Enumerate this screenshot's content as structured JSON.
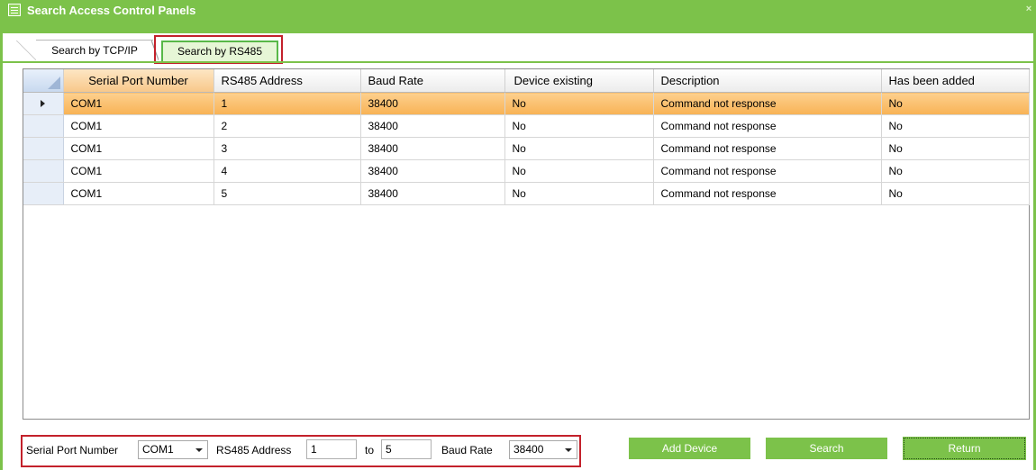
{
  "window": {
    "title": "Search Access Control Panels",
    "close_glyph": "×",
    "accent_color": "#7cc24a",
    "highlight_color": "#c3212b"
  },
  "tabs": [
    {
      "label": "Search by TCP/IP",
      "active": false
    },
    {
      "label": "Search by RS485",
      "active": true
    }
  ],
  "grid": {
    "columns": [
      "Serial Port Number",
      "RS485 Address",
      "Baud Rate",
      "Device existing",
      "Description",
      "Has been added"
    ],
    "rows": [
      {
        "port": "COM1",
        "address": "1",
        "baud": "38400",
        "exists": "No",
        "description": "Command not response",
        "added": "No",
        "selected": true
      },
      {
        "port": "COM1",
        "address": "2",
        "baud": "38400",
        "exists": "No",
        "description": "Command not response",
        "added": "No",
        "selected": false
      },
      {
        "port": "COM1",
        "address": "3",
        "baud": "38400",
        "exists": "No",
        "description": "Command not response",
        "added": "No",
        "selected": false
      },
      {
        "port": "COM1",
        "address": "4",
        "baud": "38400",
        "exists": "No",
        "description": "Command not response",
        "added": "No",
        "selected": false
      },
      {
        "port": "COM1",
        "address": "5",
        "baud": "38400",
        "exists": "No",
        "description": "Command not response",
        "added": "No",
        "selected": false
      }
    ]
  },
  "filters": {
    "serial_port_label": "Serial Port Number",
    "serial_port_value": "COM1",
    "rs485_label": "RS485 Address",
    "rs485_from": "1",
    "to_label": "to",
    "rs485_to": "5",
    "baud_label": "Baud Rate",
    "baud_value": "38400"
  },
  "buttons": {
    "add_device": "Add Device",
    "search": "Search",
    "return": "Return"
  }
}
